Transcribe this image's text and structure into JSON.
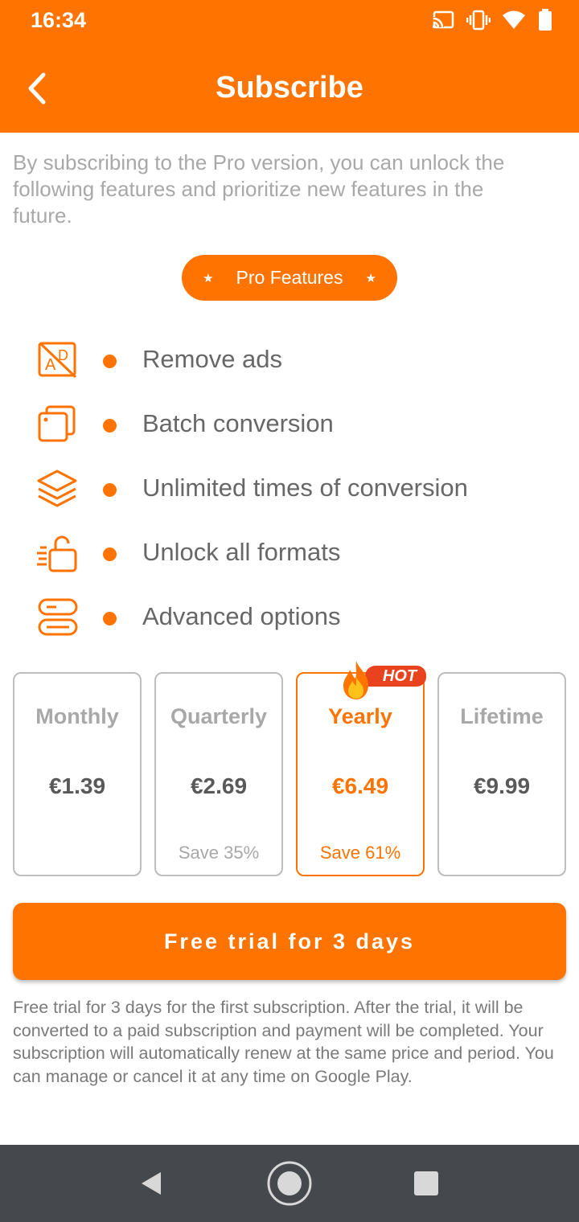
{
  "status_bar": {
    "time": "16:34",
    "icons": [
      "cast-icon",
      "vibrate-icon",
      "wifi-icon",
      "battery-icon"
    ]
  },
  "header": {
    "title": "Subscribe",
    "back_icon": "back-arrow-icon",
    "background_color": "#ff7300"
  },
  "intro_text": "By subscribing to the Pro version, you can unlock the following features and prioritize new features in the future.",
  "pro_features_label": "Pro Features",
  "features": [
    {
      "icon": "remove-ads-icon",
      "label": "Remove ads"
    },
    {
      "icon": "batch-conversion-icon",
      "label": "Batch conversion"
    },
    {
      "icon": "layers-icon",
      "label": "Unlimited times of conversion"
    },
    {
      "icon": "unlock-icon",
      "label": "Unlock all formats"
    },
    {
      "icon": "toggle-options-icon",
      "label": "Advanced options"
    }
  ],
  "plans": [
    {
      "name": "Monthly",
      "price": "€1.39",
      "save": "",
      "selected": false
    },
    {
      "name": "Quarterly",
      "price": "€2.69",
      "save": "Save 35%",
      "selected": false
    },
    {
      "name": "Yearly",
      "price": "€6.49",
      "save": "Save 61%",
      "selected": true,
      "badge": "HOT"
    },
    {
      "name": "Lifetime",
      "price": "€9.99",
      "save": "",
      "selected": false
    }
  ],
  "trial_button_label": "Free trial for 3 days",
  "terms_text": "Free trial for 3 days for the first subscription. After the trial, it will be converted to a paid subscription and payment will be completed. Your subscription will automatically renew at the same price and period. You can manage or cancel it at any time on Google Play.",
  "accent_color": "#ff7300",
  "hot_badge_color": "#e8421e",
  "nav_bar": {
    "buttons": [
      "nav-back-icon",
      "nav-home-icon",
      "nav-recents-icon"
    ]
  }
}
